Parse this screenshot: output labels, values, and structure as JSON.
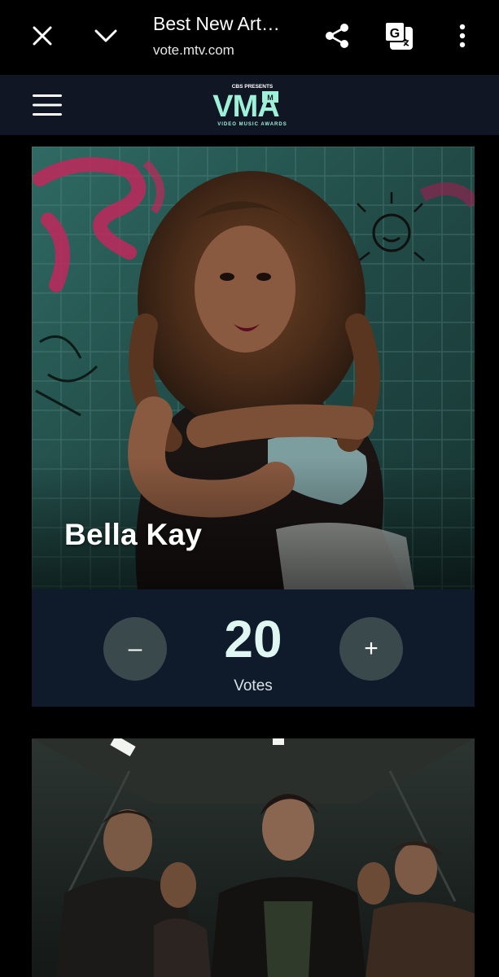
{
  "browser": {
    "title": "Best New Art…",
    "url": "vote.mtv.com",
    "icons": {
      "close": "close-icon",
      "collapse": "chevron-down-icon",
      "share": "share-icon",
      "translate": "translate-icon",
      "menu": "more-vertical-icon"
    }
  },
  "header": {
    "menu_icon": "hamburger-icon",
    "logo": {
      "presenter": "CBS PRESENTS",
      "wordmark": "VMA",
      "subtitle": "VIDEO MUSIC AWARDS"
    }
  },
  "nominees": [
    {
      "name": "Bella Kay",
      "votes": "20",
      "votes_label": "Votes",
      "minus_label": "–",
      "plus_label": "+"
    }
  ],
  "colors": {
    "background": "#000000",
    "header_bg": "#101623",
    "panel_bg": "#0f1a2b",
    "button_bg": "#3a4a4c",
    "accent_mint": "#9ff0d9"
  }
}
